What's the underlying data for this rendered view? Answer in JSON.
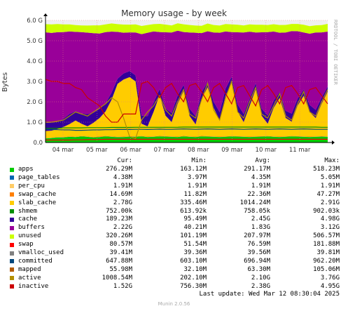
{
  "chart_data": {
    "type": "area",
    "title": "Memory usage - by week",
    "ylabel": "Bytes",
    "side_label": "RRDTOOL / TOBI OETIKER",
    "y_ticks": [
      "0.0",
      "1.0 G",
      "2.0 G",
      "3.0 G",
      "4.0 G",
      "5.0 G",
      "6.0 G"
    ],
    "ylim": [
      0,
      6.0
    ],
    "x_ticks": [
      "04 mar",
      "05 mar",
      "06 mar",
      "07 mar",
      "08 mar",
      "09 mar",
      "10 mar",
      "11 mar"
    ],
    "grid": true,
    "stack_series": [
      {
        "name": "apps",
        "color": "#00cc00",
        "values": [
          0.2,
          0.22,
          0.25,
          0.25,
          0.28,
          0.27,
          0.3,
          0.28,
          0.25,
          0.27,
          0.3,
          0.28,
          0.26,
          0.27,
          0.29,
          0.28,
          0.3,
          0.27,
          0.28,
          0.3,
          0.29,
          0.28,
          0.27,
          0.3,
          0.28,
          0.27,
          0.3,
          0.29,
          0.28,
          0.27,
          0.28,
          0.3,
          0.29,
          0.28,
          0.27,
          0.28,
          0.29,
          0.3,
          0.28,
          0.27,
          0.28,
          0.3,
          0.29,
          0.28,
          0.27,
          0.28,
          0.29,
          0.28
        ]
      },
      {
        "name": "page_tables",
        "color": "#0066b3",
        "values": [
          0.004,
          0.004,
          0.004,
          0.004,
          0.004,
          0.004,
          0.004,
          0.004,
          0.004,
          0.004,
          0.004,
          0.004,
          0.004,
          0.004,
          0.004,
          0.004,
          0.004,
          0.004,
          0.004,
          0.004,
          0.004,
          0.004,
          0.004,
          0.004,
          0.004,
          0.004,
          0.004,
          0.004,
          0.004,
          0.004,
          0.004,
          0.004,
          0.004,
          0.004,
          0.004,
          0.004,
          0.004,
          0.004,
          0.004,
          0.004,
          0.004,
          0.004,
          0.004,
          0.004,
          0.004,
          0.004,
          0.004,
          0.004
        ]
      },
      {
        "name": "swap_cache",
        "color": "#ff8000",
        "values": [
          0.01,
          0.01,
          0.012,
          0.015,
          0.02,
          0.01,
          0.015,
          0.012,
          0.02,
          0.03,
          0.02,
          0.015,
          0.02,
          0.02,
          0.015,
          0.02,
          0.02,
          0.018,
          0.02,
          0.022,
          0.02,
          0.018,
          0.02,
          0.022,
          0.02,
          0.02,
          0.022,
          0.02,
          0.018,
          0.02,
          0.022,
          0.02,
          0.02,
          0.018,
          0.02,
          0.022,
          0.02,
          0.02,
          0.018,
          0.02,
          0.022,
          0.02,
          0.02,
          0.018,
          0.02,
          0.02,
          0.015,
          0.015
        ]
      },
      {
        "name": "slab_cache",
        "color": "#ffcc00",
        "values": [
          0.35,
          0.35,
          0.4,
          0.5,
          0.6,
          0.8,
          0.6,
          0.5,
          0.7,
          0.9,
          1.2,
          1.8,
          2.6,
          2.8,
          2.9,
          2.7,
          0.6,
          0.5,
          1.2,
          2.0,
          1.0,
          0.7,
          1.6,
          2.2,
          1.0,
          0.6,
          1.8,
          2.4,
          1.4,
          0.8,
          2.0,
          2.6,
          1.2,
          0.7,
          1.5,
          2.3,
          1.0,
          0.6,
          1.4,
          1.9,
          0.9,
          0.7,
          1.5,
          2.0,
          1.2,
          0.9,
          1.6,
          2.2
        ]
      },
      {
        "name": "cache",
        "color": "#330099",
        "values": [
          0.4,
          0.4,
          0.35,
          0.4,
          0.5,
          0.45,
          0.5,
          0.6,
          0.5,
          0.45,
          0.4,
          0.35,
          0.25,
          0.3,
          0.3,
          0.3,
          0.4,
          0.5,
          0.45,
          0.3,
          0.35,
          0.45,
          0.4,
          0.3,
          0.35,
          0.4,
          0.35,
          0.25,
          0.3,
          0.4,
          0.35,
          0.3,
          0.35,
          0.4,
          0.35,
          0.3,
          0.35,
          0.4,
          0.35,
          0.3,
          0.35,
          0.4,
          0.35,
          0.3,
          0.35,
          0.4,
          0.3,
          0.25
        ]
      },
      {
        "name": "buffers",
        "color": "#990099",
        "values": [
          4.45,
          4.4,
          4.4,
          4.25,
          4.05,
          3.9,
          4.0,
          4.0,
          3.9,
          3.7,
          3.5,
          3.0,
          2.3,
          2.0,
          1.9,
          2.1,
          4.0,
          4.1,
          3.5,
          2.8,
          3.75,
          3.95,
          3.2,
          2.6,
          3.75,
          4.1,
          2.9,
          2.5,
          3.4,
          3.9,
          2.8,
          2.2,
          3.55,
          4.0,
          3.3,
          2.5,
          3.75,
          4.1,
          3.4,
          2.9,
          3.85,
          4.05,
          3.3,
          2.8,
          3.5,
          3.8,
          3.2,
          2.7
        ]
      },
      {
        "name": "unused",
        "color": "#ccff00",
        "values": [
          0.4,
          0.42,
          0.4,
          0.38,
          0.35,
          0.33,
          0.33,
          0.35,
          0.38,
          0.4,
          0.38,
          0.4,
          0.38,
          0.4,
          0.38,
          0.4,
          0.4,
          0.38,
          0.36,
          0.4,
          0.38,
          0.35,
          0.36,
          0.38,
          0.37,
          0.35,
          0.36,
          0.38,
          0.37,
          0.35,
          0.36,
          0.38,
          0.37,
          0.35,
          0.36,
          0.38,
          0.37,
          0.35,
          0.36,
          0.38,
          0.37,
          0.35,
          0.36,
          0.38,
          0.37,
          0.35,
          0.36,
          0.38
        ]
      }
    ],
    "line_series": [
      {
        "name": "shmem",
        "color": "#008f00",
        "values": [
          0.7,
          0.7,
          0.7,
          0.72,
          0.72,
          0.72,
          0.72,
          0.73,
          0.73,
          0.73,
          0.73,
          0.74,
          0.74,
          0.74,
          0.74,
          0.75,
          0.75,
          0.75,
          0.75,
          0.75,
          0.75,
          0.75,
          0.75,
          0.76,
          0.76,
          0.76,
          0.76,
          0.76,
          0.76,
          0.76,
          0.76,
          0.76,
          0.76,
          0.76,
          0.76,
          0.76,
          0.76,
          0.76,
          0.76,
          0.76,
          0.76,
          0.76,
          0.76,
          0.76,
          0.76,
          0.76,
          0.75,
          0.75
        ]
      },
      {
        "name": "committed",
        "color": "#00487d",
        "values": [
          0.65,
          0.64,
          0.63,
          0.62,
          0.62,
          0.6,
          0.6,
          0.61,
          0.62,
          0.62,
          0.63,
          0.63,
          0.64,
          0.64,
          0.64,
          0.65,
          0.65,
          0.64,
          0.65,
          0.66,
          0.65,
          0.65,
          0.66,
          0.67,
          0.66,
          0.65,
          0.66,
          0.67,
          0.66,
          0.65,
          0.66,
          0.67,
          0.66,
          0.65,
          0.66,
          0.67,
          0.66,
          0.65,
          0.66,
          0.67,
          0.66,
          0.65,
          0.66,
          0.67,
          0.66,
          0.65,
          0.65,
          0.65
        ]
      },
      {
        "name": "swap",
        "color": "#ff0000",
        "values": [
          0.12,
          0.12,
          0.12,
          0.12,
          0.12,
          0.13,
          0.13,
          0.14,
          0.14,
          0.15,
          0.16,
          0.16,
          0.16,
          0.16,
          0.16,
          0.16,
          0.16,
          0.16,
          0.16,
          0.16,
          0.16,
          0.16,
          0.16,
          0.16,
          0.16,
          0.16,
          0.16,
          0.16,
          0.16,
          0.16,
          0.16,
          0.16,
          0.16,
          0.16,
          0.16,
          0.16,
          0.16,
          0.16,
          0.16,
          0.16,
          0.16,
          0.16,
          0.16,
          0.16,
          0.16,
          0.16,
          0.16,
          0.16
        ]
      },
      {
        "name": "active",
        "color": "#b38f00",
        "values": [
          1.0,
          1.0,
          1.05,
          1.1,
          1.3,
          1.5,
          1.4,
          1.3,
          1.5,
          1.7,
          1.9,
          2.2,
          2.0,
          1.2,
          0.3,
          0.2,
          1.1,
          1.5,
          1.8,
          2.3,
          1.6,
          1.3,
          2.0,
          2.6,
          1.4,
          1.2,
          2.1,
          2.9,
          1.6,
          1.1,
          2.2,
          3.0,
          1.5,
          1.2,
          2.0,
          2.7,
          1.4,
          1.2,
          1.8,
          2.4,
          1.3,
          1.1,
          1.9,
          2.5,
          1.5,
          1.3,
          2.0,
          2.6
        ]
      },
      {
        "name": "inactive",
        "color": "#cc0000",
        "values": [
          3.1,
          3.0,
          3.0,
          2.9,
          2.9,
          2.7,
          2.6,
          2.2,
          2.0,
          1.8,
          1.3,
          1.0,
          1.0,
          1.4,
          1.4,
          1.4,
          2.9,
          3.0,
          2.7,
          2.2,
          2.7,
          2.9,
          2.4,
          2.0,
          2.8,
          2.9,
          2.5,
          2.0,
          2.7,
          2.9,
          2.4,
          1.9,
          2.7,
          2.8,
          2.3,
          1.8,
          2.6,
          2.8,
          2.4,
          1.9,
          2.7,
          2.8,
          2.4,
          1.9,
          2.6,
          2.7,
          2.3,
          1.9
        ]
      }
    ]
  },
  "legend": {
    "headers": {
      "cur": "Cur:",
      "min": "Min:",
      "avg": "Avg:",
      "max": "Max:"
    },
    "rows": [
      {
        "name": "apps",
        "color": "#00cc00",
        "cur": "276.29M",
        "min": "163.12M",
        "avg": "291.17M",
        "max": "518.23M"
      },
      {
        "name": "page_tables",
        "color": "#0066b3",
        "cur": "4.38M",
        "min": "3.97M",
        "avg": "4.35M",
        "max": "5.05M"
      },
      {
        "name": "per_cpu",
        "color": "#ffcc66",
        "cur": "1.91M",
        "min": "1.91M",
        "avg": "1.91M",
        "max": "1.91M"
      },
      {
        "name": "swap_cache",
        "color": "#ff8000",
        "cur": "14.69M",
        "min": "11.82M",
        "avg": "22.36M",
        "max": "47.27M"
      },
      {
        "name": "slab_cache",
        "color": "#ffcc00",
        "cur": "2.78G",
        "min": "335.46M",
        "avg": "1014.24M",
        "max": "2.91G"
      },
      {
        "name": "shmem",
        "color": "#008f00",
        "cur": "752.00k",
        "min": "613.92k",
        "avg": "758.05k",
        "max": "902.03k"
      },
      {
        "name": "cache",
        "color": "#330099",
        "cur": "189.23M",
        "min": "95.49M",
        "avg": "2.45G",
        "max": "4.98G"
      },
      {
        "name": "buffers",
        "color": "#990099",
        "cur": "2.22G",
        "min": "40.21M",
        "avg": "1.83G",
        "max": "3.12G"
      },
      {
        "name": "unused",
        "color": "#ccff00",
        "cur": "320.26M",
        "min": "101.19M",
        "avg": "207.97M",
        "max": "506.57M"
      },
      {
        "name": "swap",
        "color": "#ff0000",
        "cur": "80.57M",
        "min": "51.54M",
        "avg": "76.59M",
        "max": "181.88M"
      },
      {
        "name": "vmalloc_used",
        "color": "#808080",
        "cur": "39.41M",
        "min": "39.36M",
        "avg": "39.56M",
        "max": "39.81M"
      },
      {
        "name": "committed",
        "color": "#00487d",
        "cur": "647.88M",
        "min": "603.10M",
        "avg": "696.94M",
        "max": "962.20M"
      },
      {
        "name": "mapped",
        "color": "#b35a00",
        "cur": "55.98M",
        "min": "32.10M",
        "avg": "63.30M",
        "max": "105.06M"
      },
      {
        "name": "active",
        "color": "#b38f00",
        "cur": "1008.54M",
        "min": "202.10M",
        "avg": "2.10G",
        "max": "3.76G"
      },
      {
        "name": "inactive",
        "color": "#cc0000",
        "cur": "1.52G",
        "min": "756.30M",
        "avg": "2.38G",
        "max": "4.95G"
      }
    ],
    "last_update": "Last update: Wed Mar 12 08:30:04 2025",
    "footer": "Munin 2.0.56"
  }
}
